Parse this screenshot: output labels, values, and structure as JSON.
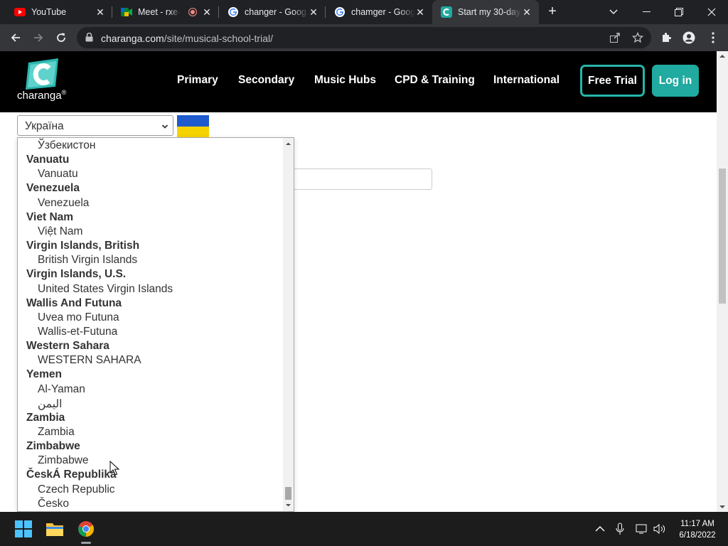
{
  "browser": {
    "tabs": [
      {
        "title": "YouTube",
        "icon": "youtube-icon"
      },
      {
        "title": "Meet - rxe-",
        "icon": "meet-icon"
      },
      {
        "title": "changer - Goog",
        "icon": "google-icon"
      },
      {
        "title": "chamger - Goog",
        "icon": "google-icon"
      },
      {
        "title": "Start my 30-day",
        "icon": "charanga-icon"
      }
    ],
    "url_domain": "charanga.com",
    "url_path": "/site/musical-school-trial/"
  },
  "site": {
    "logo_text": "charanga",
    "logo_mark": "®",
    "nav": [
      "Primary",
      "Secondary",
      "Music Hubs",
      "CPD & Training",
      "International"
    ],
    "free_trial": "Free Trial",
    "login": "Log in",
    "colors": {
      "accent": "#20aaa0",
      "header_bg": "#000000"
    }
  },
  "form": {
    "country_select_value": "Україна"
  },
  "dropdown": {
    "items": [
      {
        "type": "option",
        "text": "Ўзбекистон"
      },
      {
        "type": "group",
        "text": "Vanuatu"
      },
      {
        "type": "option",
        "text": "Vanuatu"
      },
      {
        "type": "group",
        "text": "Venezuela"
      },
      {
        "type": "option",
        "text": "Venezuela"
      },
      {
        "type": "group",
        "text": "Viet Nam"
      },
      {
        "type": "option",
        "text": "Việt Nam"
      },
      {
        "type": "group",
        "text": "Virgin Islands, British"
      },
      {
        "type": "option",
        "text": "British Virgin Islands"
      },
      {
        "type": "group",
        "text": "Virgin Islands, U.S."
      },
      {
        "type": "option",
        "text": "United States Virgin Islands"
      },
      {
        "type": "group",
        "text": "Wallis And Futuna"
      },
      {
        "type": "option",
        "text": "Uvea mo Futuna"
      },
      {
        "type": "option",
        "text": "Wallis-et-Futuna"
      },
      {
        "type": "group",
        "text": "Western Sahara"
      },
      {
        "type": "option",
        "text": "WESTERN SAHARA"
      },
      {
        "type": "group",
        "text": "Yemen"
      },
      {
        "type": "option",
        "text": "Al-Yaman"
      },
      {
        "type": "option",
        "text": "اليمن"
      },
      {
        "type": "group",
        "text": "Zambia"
      },
      {
        "type": "option",
        "text": "Zambia"
      },
      {
        "type": "group",
        "text": "Zimbabwe"
      },
      {
        "type": "option",
        "text": "Zimbabwe"
      },
      {
        "type": "group",
        "text": "ČeskÁ Republika"
      },
      {
        "type": "option",
        "text": "Czech Republic"
      },
      {
        "type": "option",
        "text": "Česko"
      }
    ]
  },
  "taskbar": {
    "time": "11:17 AM",
    "date": "6/18/2022"
  }
}
